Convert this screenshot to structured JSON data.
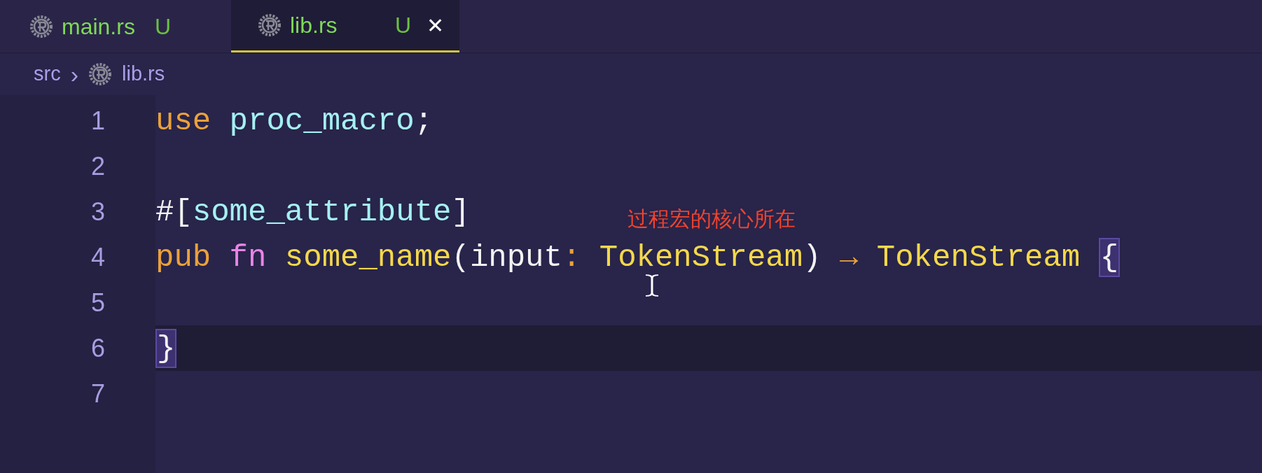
{
  "tabs": [
    {
      "label": "main.rs",
      "status": "U",
      "selected": false
    },
    {
      "label": "lib.rs",
      "status": "U",
      "selected": true,
      "close": "✕"
    }
  ],
  "breadcrumb": {
    "folder": "src",
    "separator": "›",
    "file": "lib.rs"
  },
  "lines": [
    {
      "number": "1",
      "current": false,
      "tokens": [
        {
          "text": "use",
          "kind": "keyword"
        },
        {
          "text": " proc_macro",
          "kind": "module"
        },
        {
          "text": ";",
          "kind": "plain"
        }
      ]
    },
    {
      "number": "2",
      "current": false
    },
    {
      "number": "3",
      "current": false,
      "tokens": [
        {
          "text": "#[",
          "kind": "plain"
        },
        {
          "text": "some_attribute",
          "kind": "module"
        },
        {
          "text": "]",
          "kind": "plain"
        }
      ]
    },
    {
      "number": "4",
      "current": false,
      "tokens": [
        {
          "text": "pub",
          "kind": "keyword"
        },
        {
          "text": " fn",
          "kind": "fn"
        },
        {
          "text": " some_name",
          "kind": "function"
        },
        {
          "text": "(input",
          "kind": "plain"
        },
        {
          "text": ":",
          "kind": "keyword"
        },
        {
          "text": " TokenStream",
          "kind": "type"
        },
        {
          "text": ")",
          "kind": "plain"
        },
        {
          "text": " →",
          "kind": "keyword"
        },
        {
          "text": " TokenStream ",
          "kind": "type"
        },
        {
          "text": "{",
          "kind": "bracket-match"
        }
      ]
    },
    {
      "number": "5",
      "current": false
    },
    {
      "number": "6",
      "current": true,
      "tokens": [
        {
          "text": "}",
          "kind": "bracket-match"
        }
      ]
    },
    {
      "number": "7",
      "current": false
    }
  ],
  "annotation": "过程宏的核心所在"
}
